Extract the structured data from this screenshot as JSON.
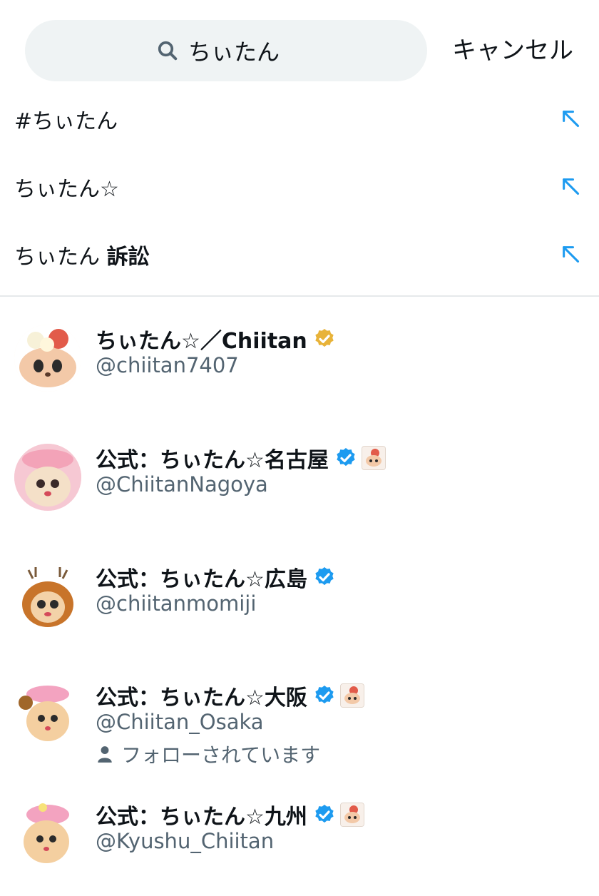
{
  "search": {
    "value": "ちぃたん",
    "cancel_label": "キャンセル"
  },
  "suggestions": [
    {
      "text": "#ちぃたん",
      "bold": ""
    },
    {
      "text": "ちぃたん☆",
      "bold": ""
    },
    {
      "text": "ちぃたん ",
      "bold": "訴訟"
    }
  ],
  "accounts": [
    {
      "name": "ちぃたん☆／Chiitan",
      "handle": "@chiitan7407",
      "verified": "gold",
      "emoji_badge": false,
      "followed_label": ""
    },
    {
      "name": "公式：ちぃたん☆名古屋",
      "handle": "@ChiitanNagoya",
      "verified": "blue",
      "emoji_badge": true,
      "followed_label": ""
    },
    {
      "name": "公式：ちぃたん☆広島",
      "handle": "@chiitanmomiji",
      "verified": "blue",
      "emoji_badge": false,
      "followed_label": ""
    },
    {
      "name": "公式：ちぃたん☆大阪",
      "handle": "@Chiitan_Osaka",
      "verified": "blue",
      "emoji_badge": true,
      "followed_label": "フォローされています"
    },
    {
      "name": "公式：ちぃたん☆九州",
      "handle": "@Kyushu_Chiitan",
      "verified": "blue",
      "emoji_badge": true,
      "followed_label": ""
    }
  ],
  "colors": {
    "accent": "#1d9bf0",
    "gold": "#e8b339",
    "secondary_text": "#536471",
    "search_bg": "#eff3f4"
  },
  "icons": {
    "search": "search-icon",
    "suggestion_arrow": "arrow-up-left-icon",
    "verified": "verified-badge-icon",
    "person": "person-icon"
  }
}
